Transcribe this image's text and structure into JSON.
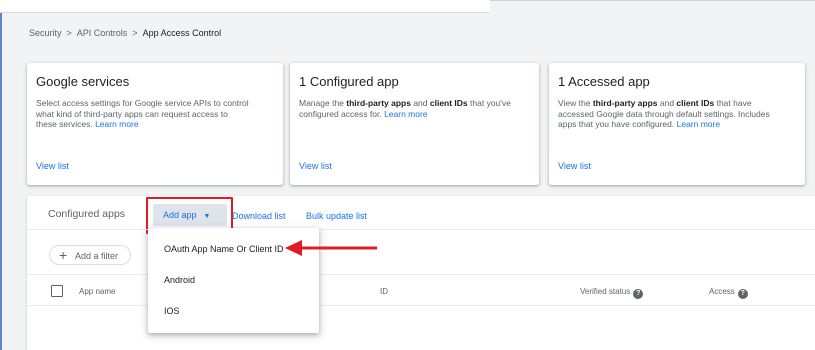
{
  "breadcrumb": {
    "items": [
      "Security",
      "API Controls"
    ],
    "current": "App Access Control",
    "separator": ">"
  },
  "cards": [
    {
      "title": "Google services",
      "desc_lines": [
        "Select access settings for Google service APIs to control",
        "what kind of third-party apps can request access to",
        "these services."
      ],
      "learn_more": "Learn more",
      "view_list": "View list"
    },
    {
      "title": "1 Configured app",
      "desc_pre": "Manage the ",
      "desc_bold1": "third-party apps",
      "desc_mid": " and ",
      "desc_bold2": "client IDs",
      "desc_post": " that you've",
      "desc_line2": "configured access for.",
      "learn_more": "Learn more",
      "view_list": "View list"
    },
    {
      "title": "1 Accessed app",
      "desc_pre": "View the ",
      "desc_bold1": "third-party apps",
      "desc_mid": " and ",
      "desc_bold2": "client IDs",
      "desc_post": " that have",
      "desc_line2": "accessed Google data through default settings. Includes",
      "desc_line3": "apps that you have configured.",
      "learn_more": "Learn more",
      "view_list": "View list"
    }
  ],
  "toolbar": {
    "section_label": "Configured apps",
    "add_app": "Add app",
    "download_list": "Download list",
    "bulk_update": "Bulk update list"
  },
  "filter": {
    "label": "Add a filter"
  },
  "table": {
    "columns": [
      "App name",
      "ID",
      "Verified status",
      "Access"
    ]
  },
  "dropdown": {
    "items": [
      "OAuth App Name Or Client ID",
      "Android",
      "IOS"
    ]
  },
  "icons": {
    "caret": "caret-down-icon",
    "plus": "plus-icon",
    "help": "help-icon",
    "arrow": "red-arrow-icon"
  },
  "colors": {
    "link": "#1a73e8",
    "highlight": "#e01b24",
    "background": "#f1f3f4"
  }
}
